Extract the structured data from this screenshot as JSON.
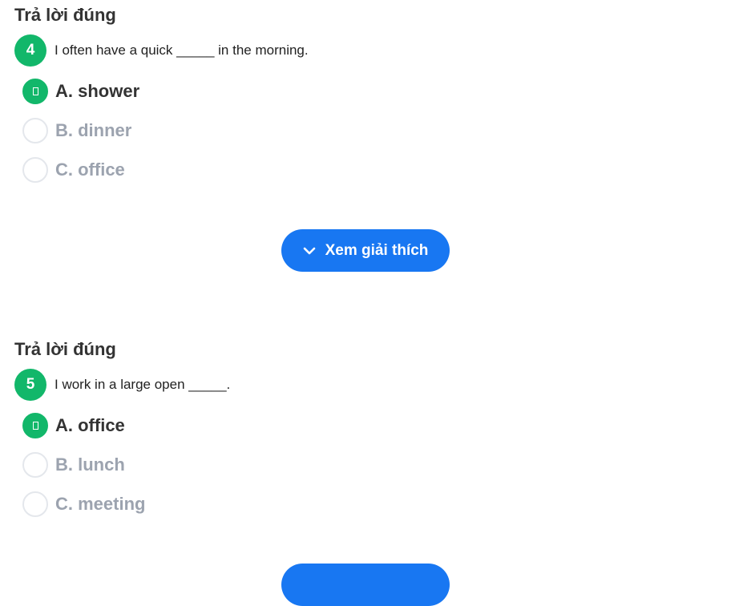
{
  "questions": [
    {
      "status": "Trả lời đúng",
      "number": "4",
      "text": "I often have a quick _____ in the morning.",
      "options": [
        {
          "label": "A. shower",
          "selected": true
        },
        {
          "label": "B. dinner",
          "selected": false
        },
        {
          "label": "C. office",
          "selected": false
        }
      ],
      "explain_label": "Xem giải thích"
    },
    {
      "status": "Trả lời đúng",
      "number": "5",
      "text": "I work in a large open _____.",
      "options": [
        {
          "label": "A. office",
          "selected": true
        },
        {
          "label": "B. lunch",
          "selected": false
        },
        {
          "label": "C. meeting",
          "selected": false
        }
      ],
      "explain_label": ""
    }
  ],
  "colors": {
    "correct_green": "#12b76a",
    "button_blue": "#1877f2",
    "option_gray": "#9ca3af"
  },
  "icons": {
    "selected_option": "check-icon",
    "explain_button": "chevron-down-icon"
  }
}
